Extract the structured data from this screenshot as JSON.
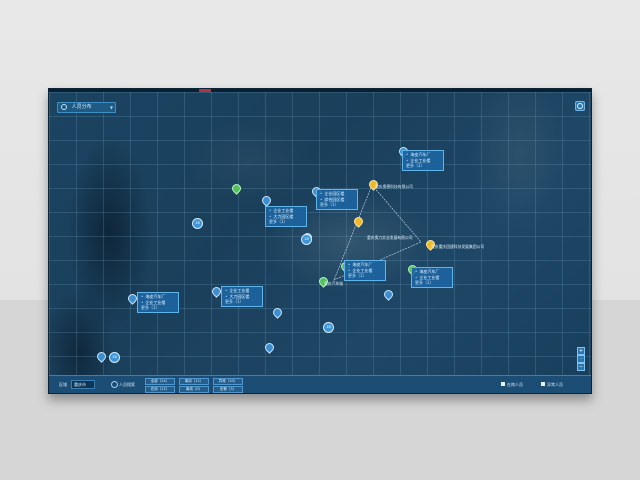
{
  "layer_select": {
    "label": "人员分布"
  },
  "map": {
    "clusters": [
      "18",
      "18",
      "18",
      "18"
    ],
    "callouts": [
      {
        "rows": [
          "海皮汽车厂",
          "企业工业楼"
        ],
        "more": "更多（1）"
      },
      {
        "rows": [
          "企业园区楼",
          "综合园区楼"
        ],
        "more": "更多（1）"
      },
      {
        "rows": [
          "企业工业楼",
          "大力园区楼"
        ],
        "more": "更多（1）"
      },
      {
        "rows": [
          "海皮汽车厂",
          "企业工业楼"
        ],
        "more": "更多（1）"
      },
      {
        "rows": [
          "海皮汽车厂",
          "企业工业楼"
        ],
        "more": "更多（1）"
      },
      {
        "rows": [
          "海皮汽车厂",
          "企业工业楼"
        ],
        "more": "更多（1）"
      },
      {
        "rows": [
          "企业工业楼",
          "大力园区楼"
        ],
        "more": "更多（1）"
      }
    ],
    "route_labels": [
      "重庆奥德科技有限公司",
      "重庆奥力实业发展有限公司",
      "重庆重庆团建科技发展集团公司",
      "重庆汽车城"
    ]
  },
  "bottom_bar": {
    "filter_label": "区域",
    "filter_value": "重庆市",
    "people_label": "人员搜索",
    "buttons": [
      "全部（24）",
      "在岗（12）",
      "离岗（12）",
      "离线（0）",
      "异常（10）",
      "告警（3）"
    ],
    "legend": [
      "在岗人员",
      "异常人员"
    ]
  }
}
